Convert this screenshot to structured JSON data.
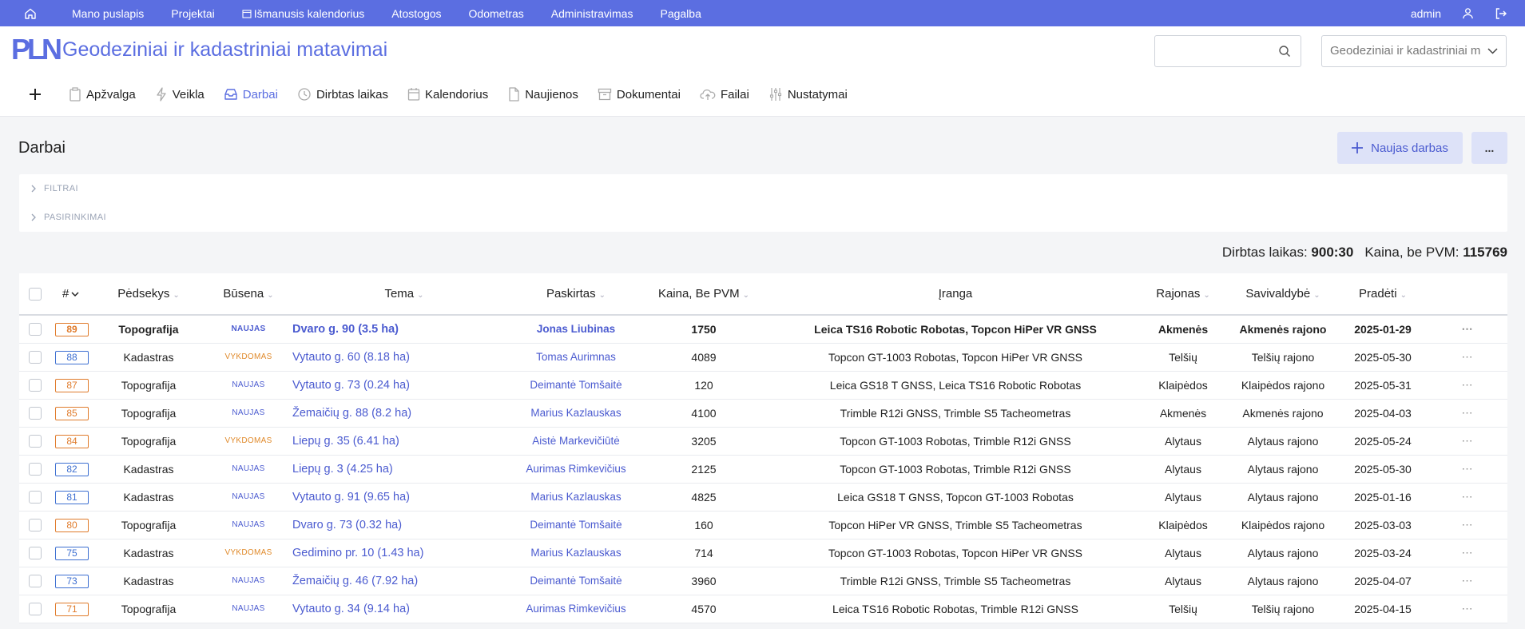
{
  "topnav": {
    "items": [
      "Mano puslapis",
      "Projektai",
      "Išmanusis kalendorius",
      "Atostogos",
      "Odometras",
      "Administravimas",
      "Pagalba"
    ],
    "user": "admin"
  },
  "header": {
    "logo": "PLN",
    "title": "Geodeziniai ir kadastriniai matavimai",
    "search_value": "",
    "project_select": "Geodeziniai ir kadastriniai m"
  },
  "tabs": [
    "Apžvalga",
    "Veikla",
    "Darbai",
    "Dirbtas laikas",
    "Kalendorius",
    "Naujienos",
    "Dokumentai",
    "Failai",
    "Nustatymai"
  ],
  "active_tab": "Darbai",
  "page": {
    "title": "Darbai",
    "new_button": "Naujas darbas",
    "more_button": "...",
    "filters_label": "FILTRAI",
    "options_label": "PASIRINKIMAI"
  },
  "totals": {
    "time_label": "Dirbtas laikas:",
    "time_value": "900:30",
    "price_label": "Kaina, be PVM:",
    "price_value": "115769"
  },
  "table": {
    "columns": [
      "#",
      "Pėdsekys",
      "Būsena",
      "Tema",
      "Paskirtas",
      "Kaina, Be PVM",
      "Įranga",
      "Rajonas",
      "Savivaldybė",
      "Pradėti"
    ],
    "rows": [
      {
        "id": "89",
        "id_color": "orange",
        "tracker": "Topografija",
        "status": "NAUJAS",
        "status_kind": "naujas",
        "subject": "Dvaro g. 90 (3.5 ha)",
        "assignee": "Jonas Liubinas",
        "price": "1750",
        "equipment": "Leica TS16 Robotic Robotas, Topcon HiPer VR GNSS",
        "district": "Akmenės",
        "municipality": "Akmenės rajono",
        "start": "2025-01-29",
        "bold": true
      },
      {
        "id": "88",
        "id_color": "blue",
        "tracker": "Kadastras",
        "status": "VYKDOMAS",
        "status_kind": "vykdomas",
        "subject": "Vytauto g. 60 (8.18 ha)",
        "assignee": "Tomas Aurimnas",
        "price": "4089",
        "equipment": "Topcon GT-1003 Robotas, Topcon HiPer VR GNSS",
        "district": "Telšių",
        "municipality": "Telšių rajono",
        "start": "2025-05-30",
        "bold": false
      },
      {
        "id": "87",
        "id_color": "orange",
        "tracker": "Topografija",
        "status": "NAUJAS",
        "status_kind": "naujas",
        "subject": "Vytauto g. 73 (0.24 ha)",
        "assignee": "Deimantė Tomšaitė",
        "price": "120",
        "equipment": "Leica GS18 T GNSS, Leica TS16 Robotic Robotas",
        "district": "Klaipėdos",
        "municipality": "Klaipėdos rajono",
        "start": "2025-05-31",
        "bold": false
      },
      {
        "id": "85",
        "id_color": "orange",
        "tracker": "Topografija",
        "status": "NAUJAS",
        "status_kind": "naujas",
        "subject": "Žemaičių g. 88 (8.2 ha)",
        "assignee": "Marius Kazlauskas",
        "price": "4100",
        "equipment": "Trimble R12i GNSS, Trimble S5 Tacheometras",
        "district": "Akmenės",
        "municipality": "Akmenės rajono",
        "start": "2025-04-03",
        "bold": false
      },
      {
        "id": "84",
        "id_color": "orange",
        "tracker": "Topografija",
        "status": "VYKDOMAS",
        "status_kind": "vykdomas",
        "subject": "Liepų g. 35 (6.41 ha)",
        "assignee": "Aistė Markevičiūtė",
        "price": "3205",
        "equipment": "Topcon GT-1003 Robotas, Trimble R12i GNSS",
        "district": "Alytaus",
        "municipality": "Alytaus rajono",
        "start": "2025-05-24",
        "bold": false
      },
      {
        "id": "82",
        "id_color": "blue",
        "tracker": "Kadastras",
        "status": "NAUJAS",
        "status_kind": "naujas",
        "subject": "Liepų g. 3 (4.25 ha)",
        "assignee": "Aurimas Rimkevičius",
        "price": "2125",
        "equipment": "Topcon GT-1003 Robotas, Trimble R12i GNSS",
        "district": "Alytaus",
        "municipality": "Alytaus rajono",
        "start": "2025-05-30",
        "bold": false
      },
      {
        "id": "81",
        "id_color": "blue",
        "tracker": "Kadastras",
        "status": "NAUJAS",
        "status_kind": "naujas",
        "subject": "Vytauto g. 91 (9.65 ha)",
        "assignee": "Marius Kazlauskas",
        "price": "4825",
        "equipment": "Leica GS18 T GNSS, Topcon GT-1003 Robotas",
        "district": "Alytaus",
        "municipality": "Alytaus rajono",
        "start": "2025-01-16",
        "bold": false
      },
      {
        "id": "80",
        "id_color": "orange",
        "tracker": "Topografija",
        "status": "NAUJAS",
        "status_kind": "naujas",
        "subject": "Dvaro g. 73 (0.32 ha)",
        "assignee": "Deimantė Tomšaitė",
        "price": "160",
        "equipment": "Topcon HiPer VR GNSS, Trimble S5 Tacheometras",
        "district": "Klaipėdos",
        "municipality": "Klaipėdos rajono",
        "start": "2025-03-03",
        "bold": false
      },
      {
        "id": "75",
        "id_color": "blue",
        "tracker": "Kadastras",
        "status": "VYKDOMAS",
        "status_kind": "vykdomas",
        "subject": "Gedimino pr. 10 (1.43 ha)",
        "assignee": "Marius Kazlauskas",
        "price": "714",
        "equipment": "Topcon GT-1003 Robotas, Topcon HiPer VR GNSS",
        "district": "Alytaus",
        "municipality": "Alytaus rajono",
        "start": "2025-03-24",
        "bold": false
      },
      {
        "id": "73",
        "id_color": "blue",
        "tracker": "Kadastras",
        "status": "NAUJAS",
        "status_kind": "naujas",
        "subject": "Žemaičių g. 46 (7.92 ha)",
        "assignee": "Deimantė Tomšaitė",
        "price": "3960",
        "equipment": "Trimble R12i GNSS, Trimble S5 Tacheometras",
        "district": "Alytaus",
        "municipality": "Alytaus rajono",
        "start": "2025-04-07",
        "bold": false
      },
      {
        "id": "71",
        "id_color": "orange",
        "tracker": "Topografija",
        "status": "NAUJAS",
        "status_kind": "naujas",
        "subject": "Vytauto g. 34 (9.14 ha)",
        "assignee": "Aurimas Rimkevičius",
        "price": "4570",
        "equipment": "Leica TS16 Robotic Robotas, Trimble R12i GNSS",
        "district": "Telšių",
        "municipality": "Telšių rajono",
        "start": "2025-04-15",
        "bold": false
      }
    ]
  }
}
